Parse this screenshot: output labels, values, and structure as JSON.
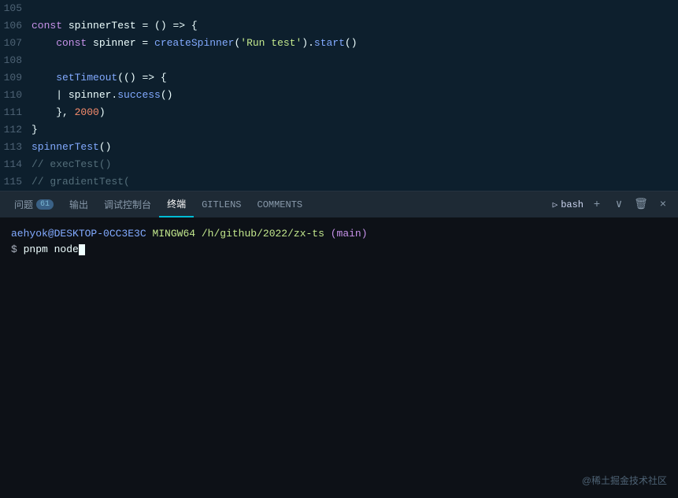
{
  "code": {
    "lines": [
      {
        "num": "105",
        "tokens": [
          {
            "text": "",
            "cls": "plain"
          }
        ]
      },
      {
        "num": "106",
        "tokens": [
          {
            "text": "const ",
            "cls": "kw"
          },
          {
            "text": "spinnerTest",
            "cls": "plain"
          },
          {
            "text": " = () => {",
            "cls": "plain"
          }
        ]
      },
      {
        "num": "107",
        "tokens": [
          {
            "text": "    const ",
            "cls": "kw"
          },
          {
            "text": "spinner",
            "cls": "plain"
          },
          {
            "text": " = ",
            "cls": "plain"
          },
          {
            "text": "createSpinner",
            "cls": "fn"
          },
          {
            "text": "(",
            "cls": "plain"
          },
          {
            "text": "'Run test'",
            "cls": "str"
          },
          {
            "text": ").",
            "cls": "plain"
          },
          {
            "text": "start",
            "cls": "fn"
          },
          {
            "text": "()",
            "cls": "plain"
          }
        ]
      },
      {
        "num": "108",
        "tokens": [
          {
            "text": "",
            "cls": "plain"
          }
        ]
      },
      {
        "num": "109",
        "tokens": [
          {
            "text": "    ",
            "cls": "plain"
          },
          {
            "text": "setTimeout",
            "cls": "fn"
          },
          {
            "text": "(() => {",
            "cls": "plain"
          }
        ]
      },
      {
        "num": "110",
        "tokens": [
          {
            "text": "    | ",
            "cls": "plain"
          },
          {
            "text": "spinner",
            "cls": "plain"
          },
          {
            "text": ".",
            "cls": "plain"
          },
          {
            "text": "success",
            "cls": "fn"
          },
          {
            "text": "()",
            "cls": "plain"
          }
        ]
      },
      {
        "num": "111",
        "tokens": [
          {
            "text": "    }, ",
            "cls": "plain"
          },
          {
            "text": "2000",
            "cls": "num"
          },
          {
            "text": ")",
            "cls": "plain"
          }
        ]
      },
      {
        "num": "112",
        "tokens": [
          {
            "text": "}",
            "cls": "plain"
          }
        ]
      },
      {
        "num": "113",
        "tokens": [
          {
            "text": "spinnerTest",
            "cls": "fn"
          },
          {
            "text": "()",
            "cls": "plain"
          }
        ]
      },
      {
        "num": "114",
        "tokens": [
          {
            "text": "// execTest()",
            "cls": "comment"
          }
        ]
      },
      {
        "num": "115",
        "tokens": [
          {
            "text": "// gradientTest(",
            "cls": "comment"
          }
        ]
      }
    ]
  },
  "tabs": {
    "items": [
      {
        "label": "问题",
        "badge": "61",
        "active": false
      },
      {
        "label": "输出",
        "badge": null,
        "active": false
      },
      {
        "label": "调试控制台",
        "badge": null,
        "active": false
      },
      {
        "label": "终端",
        "badge": null,
        "active": true
      },
      {
        "label": "GITLENS",
        "badge": null,
        "active": false
      },
      {
        "label": "COMMENTS",
        "badge": null,
        "active": false
      }
    ],
    "bash_label": "bash",
    "add_icon": "+",
    "chevron_icon": "∨",
    "trash_icon": "🗑",
    "close_icon": "×"
  },
  "terminal": {
    "prompt_user": "aehyok",
    "prompt_at": "@",
    "prompt_host": "DESKTOP-0CC3E3C",
    "prompt_space": " ",
    "prompt_shell": "MINGW64",
    "prompt_path": "/h/github/2022/zx-ts",
    "prompt_branch": "(main)",
    "cmd_dollar": "$",
    "cmd_text": " pnpm node"
  },
  "watermark": "@稀土掘金技术社区"
}
